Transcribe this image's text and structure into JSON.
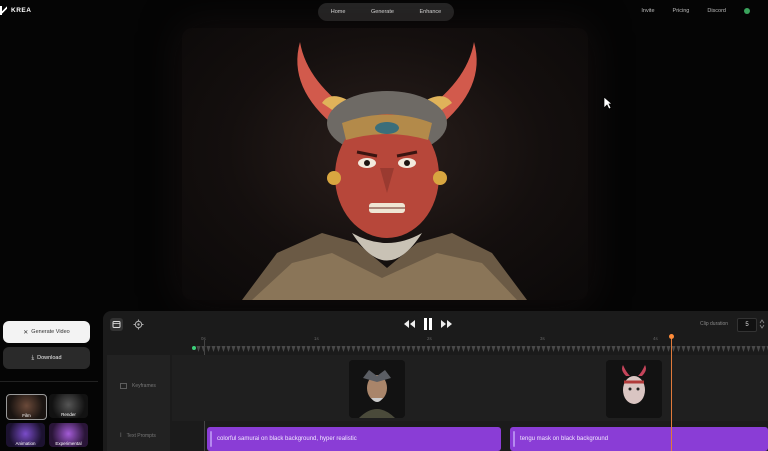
{
  "header": {
    "brand": "KREA",
    "nav": [
      "Home",
      "Generate",
      "Enhance"
    ],
    "right_links": [
      "Invite",
      "Pricing",
      "Discord"
    ]
  },
  "left_panel": {
    "generate_label": "Generate Video",
    "download_label": "Download",
    "styles": [
      "Film",
      "Render",
      "Animation",
      "Experimental"
    ]
  },
  "timeline": {
    "clip_duration_label": "Clip duration",
    "clip_duration_value": "5",
    "ruler": [
      "0s",
      "1s",
      "2s",
      "3s",
      "4s"
    ],
    "lanes": {
      "keyframes": "Keyframes",
      "text_prompts": "Text Prompts"
    },
    "prompts": [
      "colorful samurai on black background, hyper realistic",
      "tengu mask on black background"
    ]
  },
  "colors": {
    "accent_purple": "#8a3dd6",
    "playhead": "#e07a3a",
    "start_marker": "#3ccf7a"
  }
}
